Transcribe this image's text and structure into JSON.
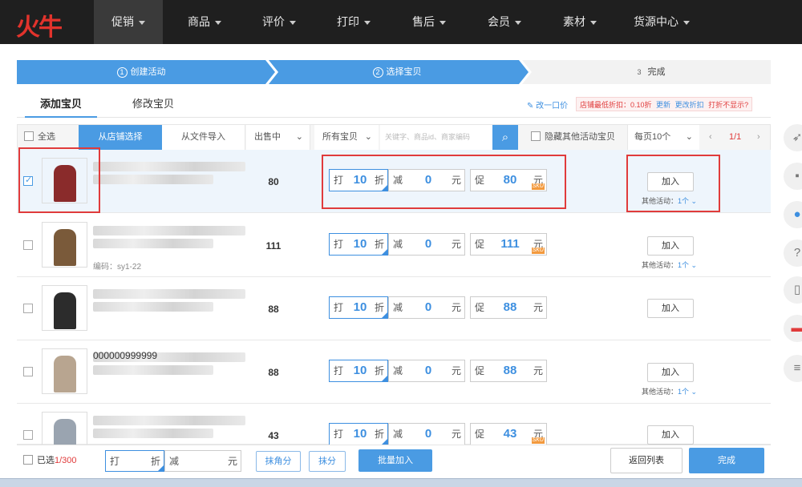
{
  "brand": {
    "logo_text": "火牛"
  },
  "nav": [
    {
      "label": "促销",
      "active": true
    },
    {
      "label": "商品"
    },
    {
      "label": "评价"
    },
    {
      "label": "打印"
    },
    {
      "label": "售后"
    },
    {
      "label": "会员"
    },
    {
      "label": "素材"
    },
    {
      "label": "货源中心"
    }
  ],
  "steps": [
    {
      "num": "1",
      "label": "创建活动"
    },
    {
      "num": "2",
      "label": "选择宝贝"
    },
    {
      "num": "3",
      "label": "完成"
    }
  ],
  "tabs": {
    "add": "添加宝贝",
    "modify": "修改宝贝"
  },
  "tab_links": {
    "change_price": "改一口价",
    "min_discount": "店铺最低折扣：0.10折",
    "update": "更新",
    "change_discount": "更改折扣",
    "discount_not_shown": "打折不显示?"
  },
  "toolbar": {
    "select_all": "全选",
    "from_store": "从店铺选择",
    "from_file": "从文件导入",
    "on_sale": "出售中",
    "all_items": "所有宝贝",
    "search_placeholder": "关键字、商品id、商家编码",
    "hide_other": "隐藏其他活动宝贝",
    "per_page": "每页10个",
    "page": "1/1"
  },
  "labels": {
    "da": "打",
    "zhe": "折",
    "jian": "减",
    "yuan": "元",
    "cu": "促",
    "add": "加入",
    "other_activity": "其他活动：",
    "other_count": "1个",
    "code_prefix": "编码："
  },
  "products": [
    {
      "title": "",
      "code": "",
      "sold": "80",
      "discount": "10",
      "reduce": "0",
      "promo": "80",
      "checked": true,
      "other": true,
      "sku_tag": true,
      "thumb_color": "#8a2b2b"
    },
    {
      "title": "",
      "code": "sy1-22",
      "sold": "111",
      "discount": "10",
      "reduce": "0",
      "promo": "111",
      "checked": false,
      "other": true,
      "sku_tag": true,
      "thumb_color": "#7a5a3a"
    },
    {
      "title": "",
      "code": "",
      "sold": "88",
      "discount": "10",
      "reduce": "0",
      "promo": "88",
      "checked": false,
      "other": false,
      "sku_tag": false,
      "thumb_color": "#2c2c2c"
    },
    {
      "title": "000000999999",
      "code": "",
      "sold": "88",
      "discount": "10",
      "reduce": "0",
      "promo": "88",
      "checked": false,
      "other": true,
      "sku_tag": false,
      "thumb_color": "#b8a590"
    },
    {
      "title": "",
      "code": "",
      "sold": "43",
      "discount": "10",
      "reduce": "0",
      "promo": "43",
      "checked": false,
      "other": false,
      "sku_tag": true,
      "thumb_color": "#9aa4b0"
    }
  ],
  "bottom": {
    "selected_label": "已选",
    "selected_count": "1/300",
    "da": "打",
    "zhe": "折",
    "jian": "减",
    "yuan": "元",
    "round_jiao": "抹角分",
    "round_fen": "抹分",
    "batch_add": "批量加入",
    "back_list": "返回列表",
    "finish": "完成"
  },
  "colors": {
    "accent": "#4a9be3",
    "red": "#e03b3b",
    "nav_bg": "#1f1f1f"
  }
}
